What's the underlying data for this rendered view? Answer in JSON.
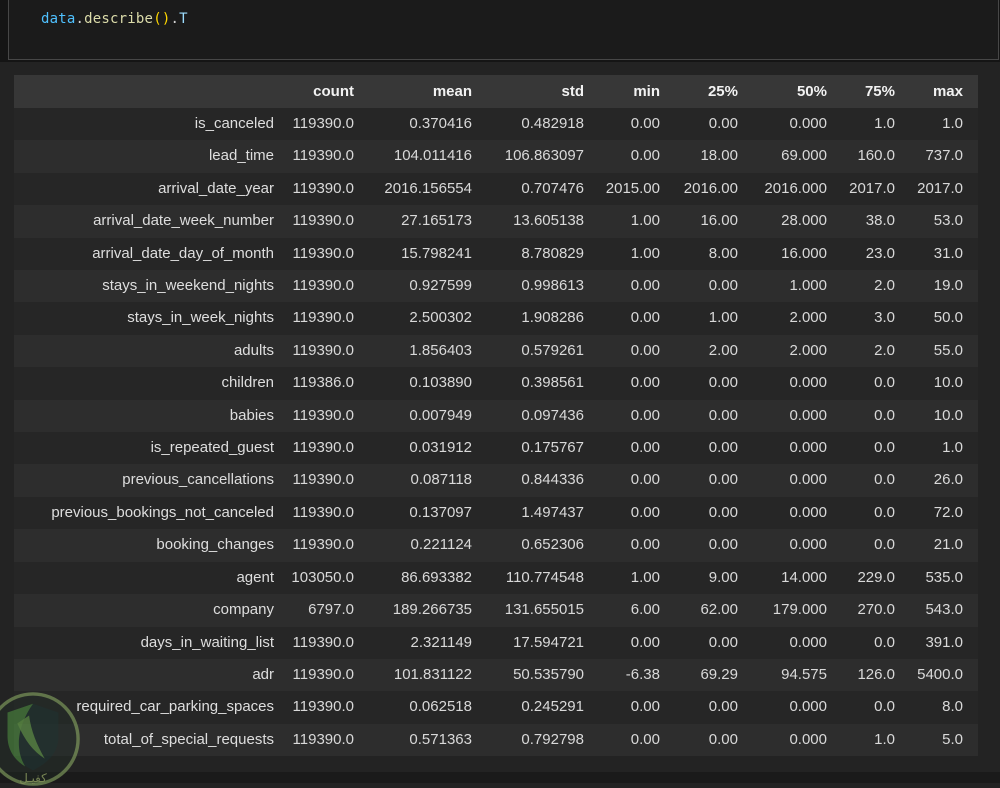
{
  "code_cell": {
    "source": "data.describe().T",
    "tokens": [
      {
        "text": "data",
        "color": "#4FC1FF"
      },
      {
        "text": ".",
        "color": "#D4D4D4"
      },
      {
        "text": "describe",
        "color": "#DCDCAA"
      },
      {
        "text": "()",
        "color": "#FFD700"
      },
      {
        "text": ".",
        "color": "#D4D4D4"
      },
      {
        "text": "T",
        "color": "#9CDCFE"
      }
    ]
  },
  "table": {
    "index_header": "",
    "columns": [
      "count",
      "mean",
      "std",
      "min",
      "25%",
      "50%",
      "75%",
      "max"
    ],
    "rows": [
      {
        "label": "is_canceled",
        "values": [
          "119390.0",
          "0.370416",
          "0.482918",
          "0.00",
          "0.00",
          "0.000",
          "1.0",
          "1.0"
        ]
      },
      {
        "label": "lead_time",
        "values": [
          "119390.0",
          "104.011416",
          "106.863097",
          "0.00",
          "18.00",
          "69.000",
          "160.0",
          "737.0"
        ]
      },
      {
        "label": "arrival_date_year",
        "values": [
          "119390.0",
          "2016.156554",
          "0.707476",
          "2015.00",
          "2016.00",
          "2016.000",
          "2017.0",
          "2017.0"
        ]
      },
      {
        "label": "arrival_date_week_number",
        "values": [
          "119390.0",
          "27.165173",
          "13.605138",
          "1.00",
          "16.00",
          "28.000",
          "38.0",
          "53.0"
        ]
      },
      {
        "label": "arrival_date_day_of_month",
        "values": [
          "119390.0",
          "15.798241",
          "8.780829",
          "1.00",
          "8.00",
          "16.000",
          "23.0",
          "31.0"
        ]
      },
      {
        "label": "stays_in_weekend_nights",
        "values": [
          "119390.0",
          "0.927599",
          "0.998613",
          "0.00",
          "0.00",
          "1.000",
          "2.0",
          "19.0"
        ]
      },
      {
        "label": "stays_in_week_nights",
        "values": [
          "119390.0",
          "2.500302",
          "1.908286",
          "0.00",
          "1.00",
          "2.000",
          "3.0",
          "50.0"
        ]
      },
      {
        "label": "adults",
        "values": [
          "119390.0",
          "1.856403",
          "0.579261",
          "0.00",
          "2.00",
          "2.000",
          "2.0",
          "55.0"
        ]
      },
      {
        "label": "children",
        "values": [
          "119386.0",
          "0.103890",
          "0.398561",
          "0.00",
          "0.00",
          "0.000",
          "0.0",
          "10.0"
        ]
      },
      {
        "label": "babies",
        "values": [
          "119390.0",
          "0.007949",
          "0.097436",
          "0.00",
          "0.00",
          "0.000",
          "0.0",
          "10.0"
        ]
      },
      {
        "label": "is_repeated_guest",
        "values": [
          "119390.0",
          "0.031912",
          "0.175767",
          "0.00",
          "0.00",
          "0.000",
          "0.0",
          "1.0"
        ]
      },
      {
        "label": "previous_cancellations",
        "values": [
          "119390.0",
          "0.087118",
          "0.844336",
          "0.00",
          "0.00",
          "0.000",
          "0.0",
          "26.0"
        ]
      },
      {
        "label": "previous_bookings_not_canceled",
        "values": [
          "119390.0",
          "0.137097",
          "1.497437",
          "0.00",
          "0.00",
          "0.000",
          "0.0",
          "72.0"
        ]
      },
      {
        "label": "booking_changes",
        "values": [
          "119390.0",
          "0.221124",
          "0.652306",
          "0.00",
          "0.00",
          "0.000",
          "0.0",
          "21.0"
        ]
      },
      {
        "label": "agent",
        "values": [
          "103050.0",
          "86.693382",
          "110.774548",
          "1.00",
          "9.00",
          "14.000",
          "229.0",
          "535.0"
        ]
      },
      {
        "label": "company",
        "values": [
          "6797.0",
          "189.266735",
          "131.655015",
          "6.00",
          "62.00",
          "179.000",
          "270.0",
          "543.0"
        ]
      },
      {
        "label": "days_in_waiting_list",
        "values": [
          "119390.0",
          "2.321149",
          "17.594721",
          "0.00",
          "0.00",
          "0.000",
          "0.0",
          "391.0"
        ]
      },
      {
        "label": "adr",
        "values": [
          "119390.0",
          "101.831122",
          "50.535790",
          "-6.38",
          "69.29",
          "94.575",
          "126.0",
          "5400.0"
        ]
      },
      {
        "label": "required_car_parking_spaces",
        "values": [
          "119390.0",
          "0.062518",
          "0.245291",
          "0.00",
          "0.00",
          "0.000",
          "0.0",
          "8.0"
        ]
      },
      {
        "label": "total_of_special_requests",
        "values": [
          "119390.0",
          "0.571363",
          "0.792798",
          "0.00",
          "0.00",
          "0.000",
          "1.0",
          "5.0"
        ]
      }
    ]
  },
  "watermark": {
    "text": "كفيـل",
    "ring_color": "#86a561",
    "shield_green": "#4c8b3f",
    "shield_dark": "#1e3330"
  }
}
